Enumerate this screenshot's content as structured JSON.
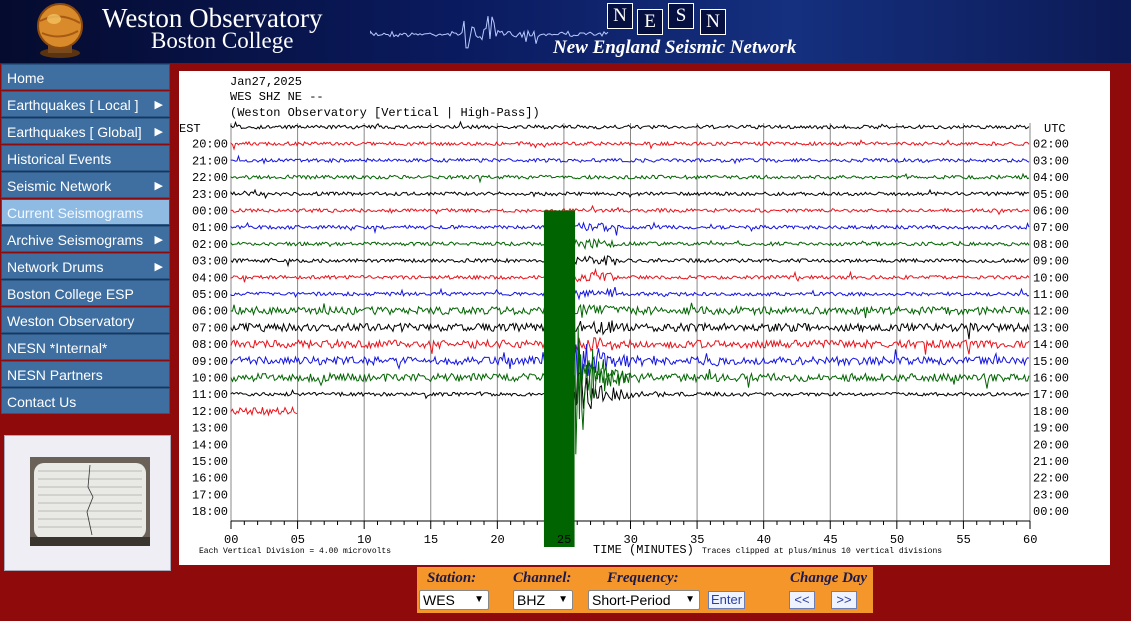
{
  "header": {
    "title": "Weston Observatory",
    "subtitle": "Boston College",
    "nesn_letters": [
      "N",
      "E",
      "S",
      "N"
    ],
    "network_name": "New England Seismic Network"
  },
  "nav": {
    "items": [
      {
        "label": "Home",
        "submenu": false,
        "active": false
      },
      {
        "label": "Earthquakes [ Local ]",
        "submenu": true,
        "active": false
      },
      {
        "label": "Earthquakes [ Global]",
        "submenu": true,
        "active": false
      },
      {
        "label": "Historical Events",
        "submenu": false,
        "active": false
      },
      {
        "label": "Seismic Network",
        "submenu": true,
        "active": false
      },
      {
        "label": "Current Seismograms",
        "submenu": false,
        "active": true
      },
      {
        "label": "Archive Seismograms",
        "submenu": true,
        "active": false
      },
      {
        "label": "Network Drums",
        "submenu": true,
        "active": false
      },
      {
        "label": "Boston College ESP",
        "submenu": false,
        "active": false
      },
      {
        "label": "Weston Observatory",
        "submenu": false,
        "active": false
      },
      {
        "label": "NESN *Internal*",
        "submenu": false,
        "active": false
      },
      {
        "label": "NESN Partners",
        "submenu": false,
        "active": false
      },
      {
        "label": "Contact Us",
        "submenu": false,
        "active": false
      }
    ],
    "arrow_glyph": "▶"
  },
  "seismogram": {
    "date": "Jan27,2025",
    "station_line": "WES SHZ NE --",
    "description": "(Weston Observatory [Vertical | High-Pass])",
    "left_label": "EST",
    "right_label": "UTC",
    "est_hours": [
      "20:00",
      "21:00",
      "22:00",
      "23:00",
      "00:00",
      "01:00",
      "02:00",
      "03:00",
      "04:00",
      "05:00",
      "06:00",
      "07:00",
      "08:00",
      "09:00",
      "10:00",
      "11:00",
      "12:00",
      "13:00",
      "14:00",
      "15:00",
      "16:00",
      "17:00",
      "18:00"
    ],
    "utc_hours": [
      "02:00",
      "03:00",
      "04:00",
      "05:00",
      "06:00",
      "07:00",
      "08:00",
      "09:00",
      "10:00",
      "11:00",
      "12:00",
      "13:00",
      "14:00",
      "15:00",
      "16:00",
      "17:00",
      "18:00",
      "19:00",
      "20:00",
      "21:00",
      "22:00",
      "23:00",
      "00:00"
    ],
    "minute_ticks": [
      "00",
      "05",
      "10",
      "15",
      "20",
      "25",
      "30",
      "35",
      "40",
      "45",
      "50",
      "55",
      "60"
    ],
    "x_axis_title": "TIME (MINUTES)",
    "scale_note": "Each Vertical Division =     4.00 microvolts",
    "clip_note": "Traces clipped at plus/minus 10 vertical divisions",
    "trace_colors": [
      "#000000",
      "#e8141c",
      "#1414e0",
      "#006400"
    ],
    "active_traces": 17,
    "event_minute": 24,
    "colors": {
      "background": "#8f0b0b",
      "nav": "#3e6fa0",
      "nav_active": "#8fbbe3",
      "controls": "#f5962a"
    }
  },
  "controls": {
    "station_label": "Station:",
    "channel_label": "Channel:",
    "frequency_label": "Frequency:",
    "change_day_label": "Change Day",
    "station_value": "WES",
    "channel_value": "BHZ",
    "frequency_value": "Short-Period",
    "enter_label": "Enter",
    "prev_label": "<<",
    "next_label": ">>"
  }
}
